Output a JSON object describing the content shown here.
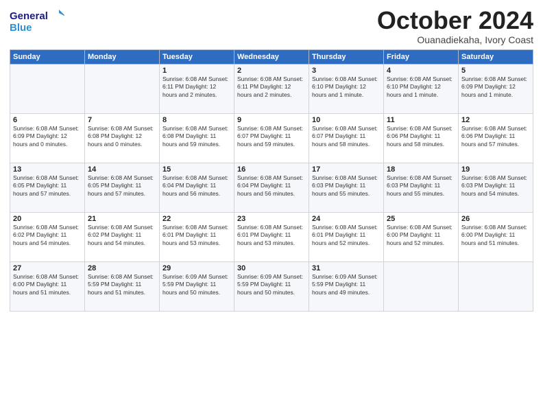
{
  "logo": {
    "line1": "General",
    "line2": "Blue"
  },
  "title": "October 2024",
  "subtitle": "Ouanadiekaha, Ivory Coast",
  "days_of_week": [
    "Sunday",
    "Monday",
    "Tuesday",
    "Wednesday",
    "Thursday",
    "Friday",
    "Saturday"
  ],
  "weeks": [
    [
      {
        "day": "",
        "detail": ""
      },
      {
        "day": "",
        "detail": ""
      },
      {
        "day": "1",
        "detail": "Sunrise: 6:08 AM\nSunset: 6:11 PM\nDaylight: 12 hours\nand 2 minutes."
      },
      {
        "day": "2",
        "detail": "Sunrise: 6:08 AM\nSunset: 6:11 PM\nDaylight: 12 hours\nand 2 minutes."
      },
      {
        "day": "3",
        "detail": "Sunrise: 6:08 AM\nSunset: 6:10 PM\nDaylight: 12 hours\nand 1 minute."
      },
      {
        "day": "4",
        "detail": "Sunrise: 6:08 AM\nSunset: 6:10 PM\nDaylight: 12 hours\nand 1 minute."
      },
      {
        "day": "5",
        "detail": "Sunrise: 6:08 AM\nSunset: 6:09 PM\nDaylight: 12 hours\nand 1 minute."
      }
    ],
    [
      {
        "day": "6",
        "detail": "Sunrise: 6:08 AM\nSunset: 6:09 PM\nDaylight: 12 hours\nand 0 minutes."
      },
      {
        "day": "7",
        "detail": "Sunrise: 6:08 AM\nSunset: 6:08 PM\nDaylight: 12 hours\nand 0 minutes."
      },
      {
        "day": "8",
        "detail": "Sunrise: 6:08 AM\nSunset: 6:08 PM\nDaylight: 11 hours\nand 59 minutes."
      },
      {
        "day": "9",
        "detail": "Sunrise: 6:08 AM\nSunset: 6:07 PM\nDaylight: 11 hours\nand 59 minutes."
      },
      {
        "day": "10",
        "detail": "Sunrise: 6:08 AM\nSunset: 6:07 PM\nDaylight: 11 hours\nand 58 minutes."
      },
      {
        "day": "11",
        "detail": "Sunrise: 6:08 AM\nSunset: 6:06 PM\nDaylight: 11 hours\nand 58 minutes."
      },
      {
        "day": "12",
        "detail": "Sunrise: 6:08 AM\nSunset: 6:06 PM\nDaylight: 11 hours\nand 57 minutes."
      }
    ],
    [
      {
        "day": "13",
        "detail": "Sunrise: 6:08 AM\nSunset: 6:05 PM\nDaylight: 11 hours\nand 57 minutes."
      },
      {
        "day": "14",
        "detail": "Sunrise: 6:08 AM\nSunset: 6:05 PM\nDaylight: 11 hours\nand 57 minutes."
      },
      {
        "day": "15",
        "detail": "Sunrise: 6:08 AM\nSunset: 6:04 PM\nDaylight: 11 hours\nand 56 minutes."
      },
      {
        "day": "16",
        "detail": "Sunrise: 6:08 AM\nSunset: 6:04 PM\nDaylight: 11 hours\nand 56 minutes."
      },
      {
        "day": "17",
        "detail": "Sunrise: 6:08 AM\nSunset: 6:03 PM\nDaylight: 11 hours\nand 55 minutes."
      },
      {
        "day": "18",
        "detail": "Sunrise: 6:08 AM\nSunset: 6:03 PM\nDaylight: 11 hours\nand 55 minutes."
      },
      {
        "day": "19",
        "detail": "Sunrise: 6:08 AM\nSunset: 6:03 PM\nDaylight: 11 hours\nand 54 minutes."
      }
    ],
    [
      {
        "day": "20",
        "detail": "Sunrise: 6:08 AM\nSunset: 6:02 PM\nDaylight: 11 hours\nand 54 minutes."
      },
      {
        "day": "21",
        "detail": "Sunrise: 6:08 AM\nSunset: 6:02 PM\nDaylight: 11 hours\nand 54 minutes."
      },
      {
        "day": "22",
        "detail": "Sunrise: 6:08 AM\nSunset: 6:01 PM\nDaylight: 11 hours\nand 53 minutes."
      },
      {
        "day": "23",
        "detail": "Sunrise: 6:08 AM\nSunset: 6:01 PM\nDaylight: 11 hours\nand 53 minutes."
      },
      {
        "day": "24",
        "detail": "Sunrise: 6:08 AM\nSunset: 6:01 PM\nDaylight: 11 hours\nand 52 minutes."
      },
      {
        "day": "25",
        "detail": "Sunrise: 6:08 AM\nSunset: 6:00 PM\nDaylight: 11 hours\nand 52 minutes."
      },
      {
        "day": "26",
        "detail": "Sunrise: 6:08 AM\nSunset: 6:00 PM\nDaylight: 11 hours\nand 51 minutes."
      }
    ],
    [
      {
        "day": "27",
        "detail": "Sunrise: 6:08 AM\nSunset: 6:00 PM\nDaylight: 11 hours\nand 51 minutes."
      },
      {
        "day": "28",
        "detail": "Sunrise: 6:08 AM\nSunset: 5:59 PM\nDaylight: 11 hours\nand 51 minutes."
      },
      {
        "day": "29",
        "detail": "Sunrise: 6:09 AM\nSunset: 5:59 PM\nDaylight: 11 hours\nand 50 minutes."
      },
      {
        "day": "30",
        "detail": "Sunrise: 6:09 AM\nSunset: 5:59 PM\nDaylight: 11 hours\nand 50 minutes."
      },
      {
        "day": "31",
        "detail": "Sunrise: 6:09 AM\nSunset: 5:59 PM\nDaylight: 11 hours\nand 49 minutes."
      },
      {
        "day": "",
        "detail": ""
      },
      {
        "day": "",
        "detail": ""
      }
    ]
  ]
}
